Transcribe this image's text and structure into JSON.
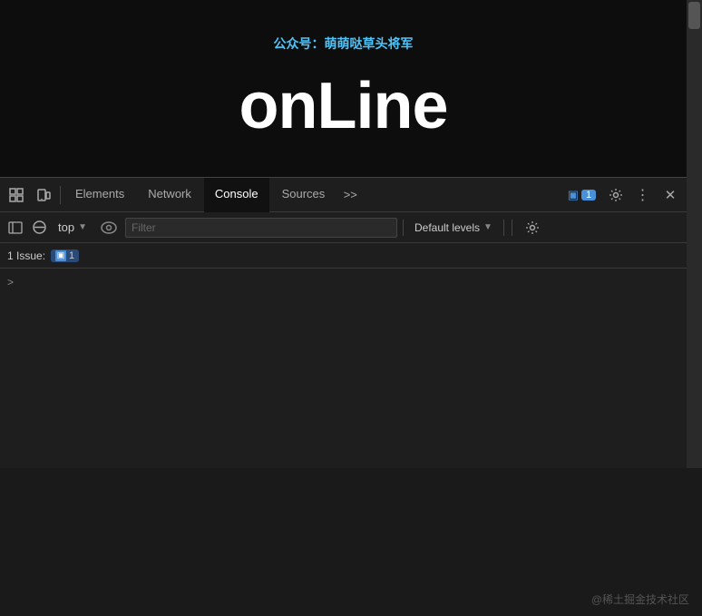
{
  "header": {
    "wechat_prefix": "公众号：",
    "wechat_name": "萌萌哒草头将军",
    "main_text": "onLine"
  },
  "devtools": {
    "tabs": [
      {
        "id": "elements",
        "label": "Elements",
        "active": false
      },
      {
        "id": "network",
        "label": "Network",
        "active": false
      },
      {
        "id": "console",
        "label": "Console",
        "active": true
      },
      {
        "id": "sources",
        "label": "Sources",
        "active": false
      }
    ],
    "badge": {
      "icon": "▣",
      "count": "1"
    },
    "toolbar2": {
      "context": "top",
      "filter_placeholder": "Filter",
      "levels_label": "Default levels"
    },
    "issues": {
      "prefix": "1 Issue:",
      "icon": "▣",
      "count": "1"
    },
    "console_prompt": ">"
  },
  "watermark": "@稀土掘金技术社区"
}
